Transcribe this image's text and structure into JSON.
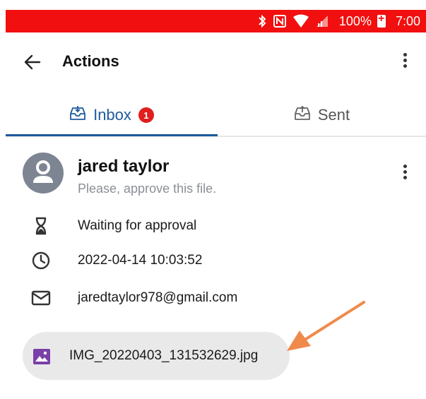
{
  "status_bar": {
    "battery_percent": "100%",
    "time": "7:00",
    "icons": [
      "bluetooth-icon",
      "nfc-icon",
      "wifi-icon",
      "signal-icon",
      "battery-charging-icon"
    ]
  },
  "app_bar": {
    "title": "Actions"
  },
  "tabs": [
    {
      "label": "Inbox",
      "badge": "1",
      "active": true
    },
    {
      "label": "Sent",
      "active": false
    }
  ],
  "message": {
    "sender": "jared taylor",
    "note": "Please, approve this file.",
    "status": "Waiting for approval",
    "datetime": "2022-04-14 10:03:52",
    "email": "jaredtaylor978@gmail.com",
    "attachment": "IMG_20220403_131532629.jpg"
  },
  "colors": {
    "status_bar": "#f10f0f",
    "accent": "#1e5a9d",
    "badge": "#e11d1d",
    "annotation_arrow": "#f08a4b"
  }
}
